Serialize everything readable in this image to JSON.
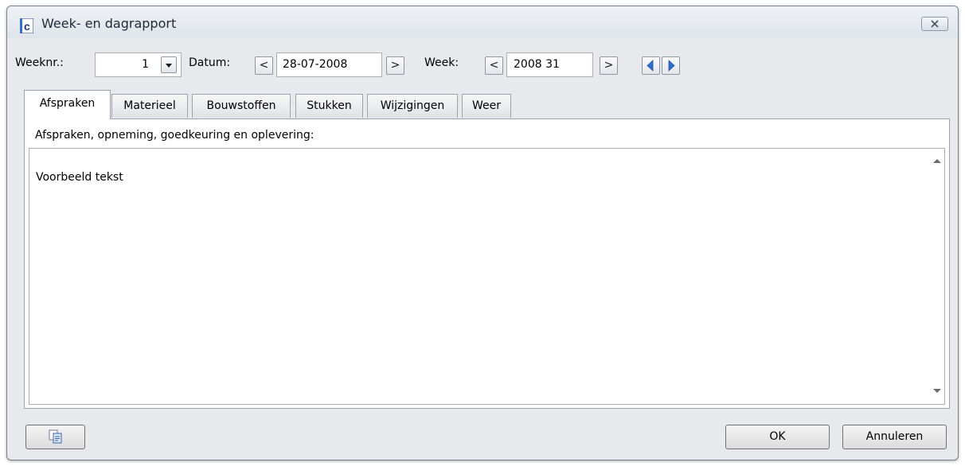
{
  "window": {
    "title": "Week- en dagrapport"
  },
  "toolbar": {
    "weeknr_label": "Weeknr.:",
    "weeknr_value": "1",
    "datum_label": "Datum:",
    "datum_value": "28-07-2008",
    "week_label": "Week:",
    "week_value": "2008 31",
    "prev_symbol": "<",
    "next_symbol": ">"
  },
  "tabs": [
    "Afspraken",
    "Materieel",
    "Bouwstoffen",
    "Stukken",
    "Wijzigingen",
    "Weer"
  ],
  "panel": {
    "section_label": "Afspraken, opneming, goedkeuring en oplevering:",
    "text": "Voorbeeld tekst"
  },
  "buttons": {
    "ok": "OK",
    "cancel": "Annuleren"
  },
  "colors": {
    "accent_blue": "#2f6fce",
    "icon_navy": "#233a7a"
  }
}
